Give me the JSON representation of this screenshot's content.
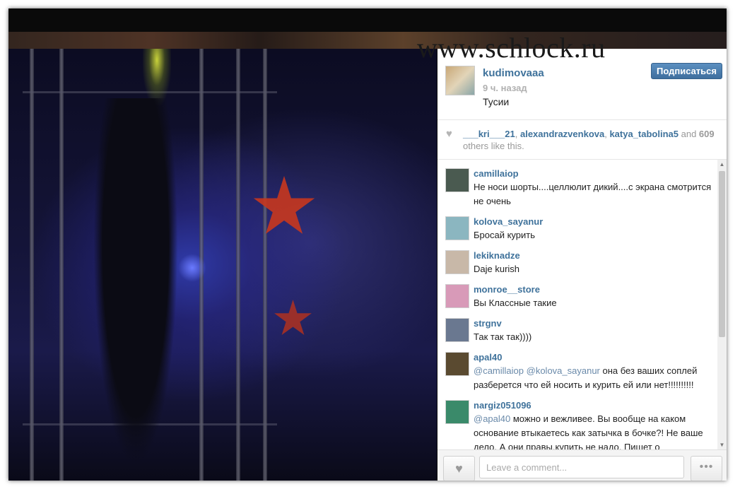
{
  "watermark": "www.schlock.ru",
  "post": {
    "username": "kudimovaaa",
    "time_ago": "9 ч. назад",
    "caption": "Тусии",
    "follow_label": "Подписаться"
  },
  "likes": {
    "users": [
      "___kri___21",
      "alexandrazvenkova",
      "katya_tabolina5"
    ],
    "sep": ", ",
    "and": " and ",
    "count": "609",
    "suffix": " others like this."
  },
  "comments": [
    {
      "user": "camillaiop",
      "text": "Не носи шорты....целлюлит дикий....с экрана смотрится не очень",
      "avatar_color": "#4a5a50"
    },
    {
      "user": "kolova_sayanur",
      "text": "Бросай курить",
      "avatar_color": "#8bb6c0"
    },
    {
      "user": "lekiknadze",
      "text": "Daje kurish",
      "avatar_color": "#c8b8a8"
    },
    {
      "user": "monroe__store",
      "text": "Вы Классные такие",
      "avatar_color": "#d89ab8"
    },
    {
      "user": "strgnv",
      "text": "Так так так))))",
      "avatar_color": "#6a7890"
    },
    {
      "user": "apal40",
      "mention1": "@camillaiop",
      "mention2": "@kolova_sayanur",
      "text": " она без ваших соплей разберется что ей носить и курить ей или нет!!!!!!!!!!",
      "avatar_color": "#5a4a30"
    },
    {
      "user": "nargiz051096",
      "mention1": "@apal40",
      "text": " можно и вежливее. Вы вообще на каком основание втыкаетесь как затычка в бочке?! Не ваше дело. А они правы,купить не надо. Пишет о",
      "avatar_color": "#3a8a6a"
    }
  ],
  "footer": {
    "comment_placeholder": "Leave a comment...",
    "more_label": "•••"
  }
}
